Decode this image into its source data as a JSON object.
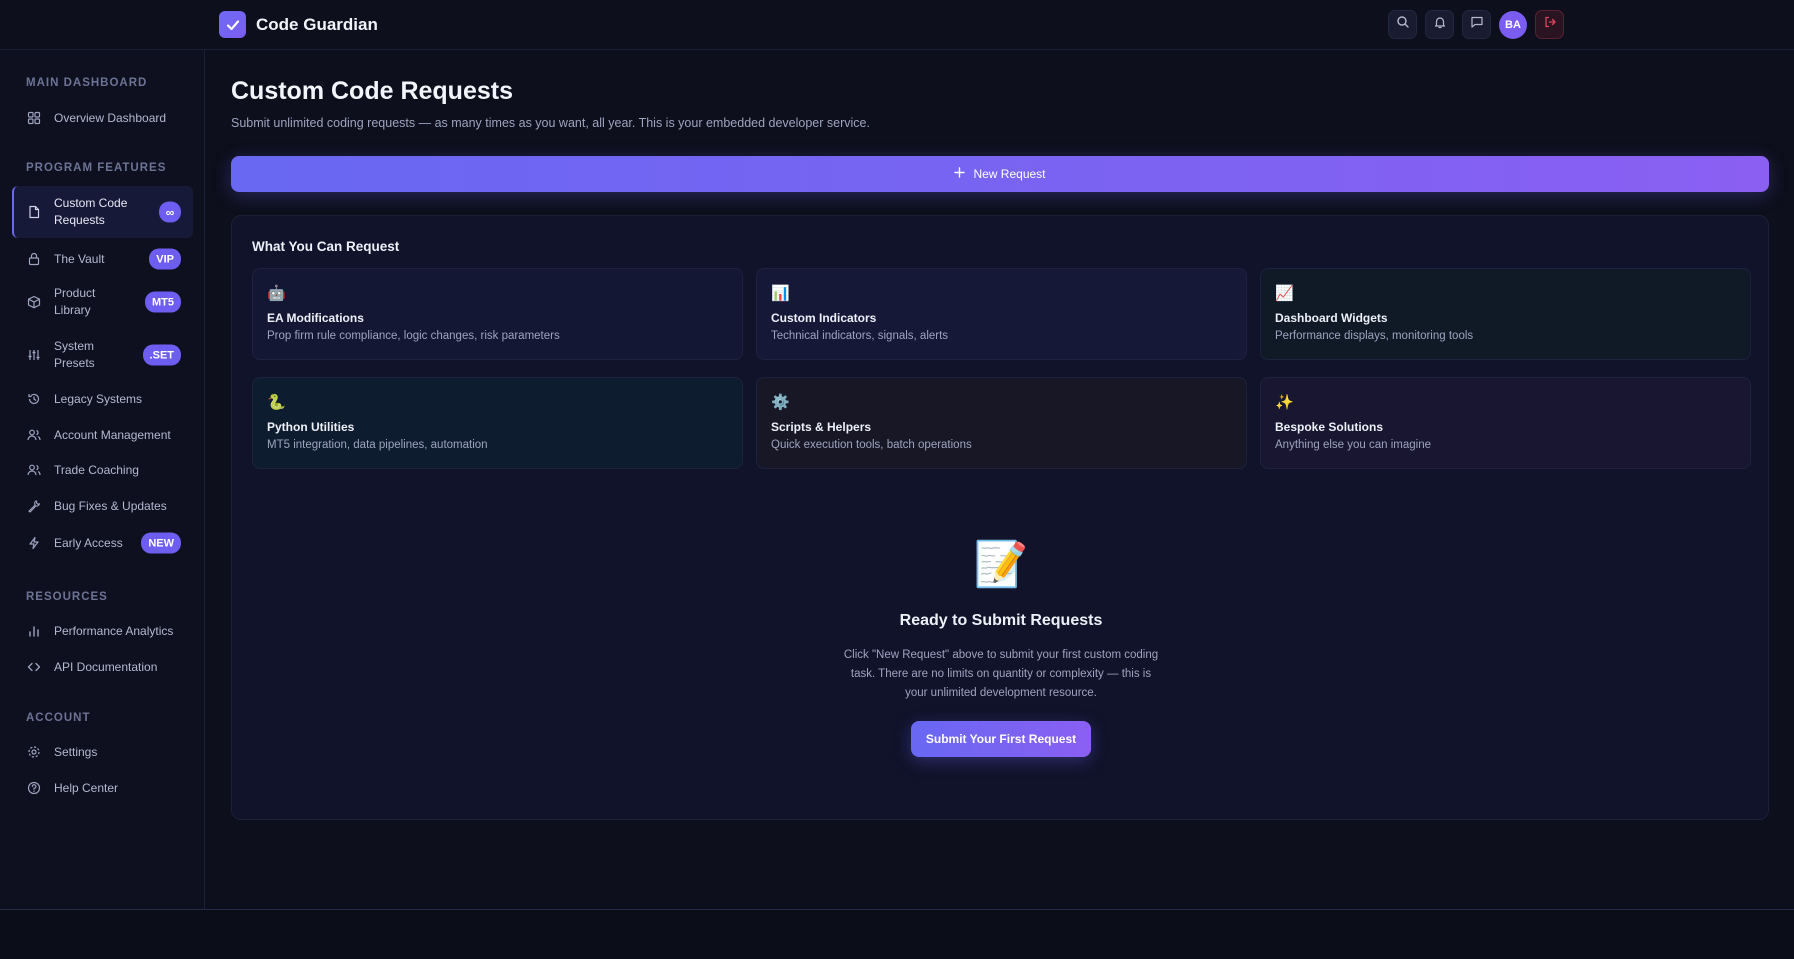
{
  "header": {
    "brand": "Code Guardian",
    "avatar_initials": "BA",
    "icons": [
      "search-icon",
      "bell-icon",
      "message-icon",
      "logout-icon"
    ]
  },
  "sidebar": {
    "sections": {
      "main": "MAIN DASHBOARD",
      "program": "PROGRAM FEATURES",
      "resources": "RESOURCES",
      "account": "ACCOUNT"
    },
    "items": [
      {
        "label": "Overview Dashboard"
      },
      {
        "label": "Custom Code Requests",
        "badge": "∞"
      },
      {
        "label": "The Vault",
        "badge": "VIP"
      },
      {
        "label": "Product Library",
        "badge": "MT5"
      },
      {
        "label": "System Presets",
        "badge": ".SET"
      },
      {
        "label": "Legacy Systems"
      },
      {
        "label": "Account Management"
      },
      {
        "label": "Trade Coaching"
      },
      {
        "label": "Bug Fixes & Updates"
      },
      {
        "label": "Early Access",
        "badge": "NEW"
      },
      {
        "label": "Performance Analytics"
      },
      {
        "label": "API Documentation"
      },
      {
        "label": "Settings"
      },
      {
        "label": "Help Center"
      }
    ]
  },
  "main": {
    "title": "Custom Code Requests",
    "subtitle": "Submit unlimited coding requests — as many times as you want, all year. This is your embedded developer service.",
    "new_request": "New Request",
    "panel_title": "What You Can Request",
    "cards": [
      {
        "emoji": "🤖",
        "title": "EA Modifications",
        "desc": "Prop firm rule compliance, logic changes, risk parameters"
      },
      {
        "emoji": "📊",
        "title": "Custom Indicators",
        "desc": "Technical indicators, signals, alerts"
      },
      {
        "emoji": "📈",
        "title": "Dashboard Widgets",
        "desc": "Performance displays, monitoring tools"
      },
      {
        "emoji": "🐍",
        "title": "Python Utilities",
        "desc": "MT5 integration, data pipelines, automation"
      },
      {
        "emoji": "⚙️",
        "title": "Scripts & Helpers",
        "desc": "Quick execution tools, batch operations"
      },
      {
        "emoji": "✨",
        "title": "Bespoke Solutions",
        "desc": "Anything else you can imagine"
      }
    ],
    "empty": {
      "emoji": "📝",
      "title": "Ready to Submit Requests",
      "text": "Click \"New Request\" above to submit your first custom coding task. There are no limits on quantity or complexity — this is your unlimited development resource.",
      "button": "Submit Your First Request"
    }
  },
  "colors": {
    "background": "#0d0f1c",
    "accent": "#6d5df0",
    "accent_gradient_end": "#8a5ff2",
    "logout": "#e0445e"
  }
}
